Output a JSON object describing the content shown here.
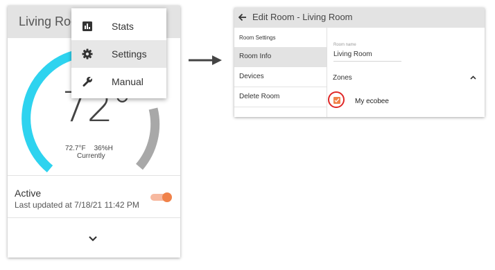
{
  "left_card": {
    "title": "Living Room",
    "temperature": "72°",
    "indoor_temp": "72.7°F",
    "humidity": "36%H",
    "currently_label": "Currently",
    "status_title": "Active",
    "last_updated": "Last updated at 7/18/21 11:42 PM",
    "toggle_on": true,
    "colors": {
      "dial_cool": "#2ed3ef",
      "dial_gray": "#a8a8a8",
      "toggle": "#f0824a"
    }
  },
  "dropdown_menu": {
    "items": [
      {
        "label": "Stats",
        "icon": "bar-chart-icon"
      },
      {
        "label": "Settings",
        "icon": "gear-icon",
        "selected": true
      },
      {
        "label": "Manual",
        "icon": "wrench-icon"
      }
    ]
  },
  "edit_room_dialog": {
    "title": "Edit Room - Living Room",
    "sidebar": {
      "items": [
        {
          "label": "Room Settings"
        },
        {
          "label": "Room Info",
          "selected": true
        },
        {
          "label": "Devices"
        },
        {
          "label": "Delete Room"
        }
      ]
    },
    "room_name_label": "Room name",
    "room_name_value": "Living Room",
    "zones_label": "Zones",
    "zone_item": {
      "label": "My ecobee",
      "checked": true
    },
    "highlight_color": "#e02626"
  }
}
